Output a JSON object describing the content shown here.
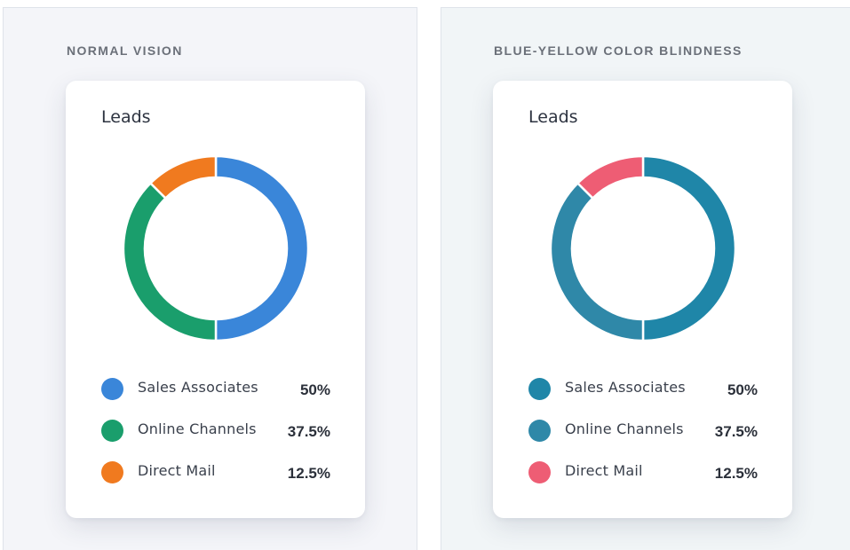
{
  "chart_data": [
    {
      "type": "pie",
      "panel_title": "NORMAL VISION",
      "title": "Leads",
      "categories": [
        "Sales Associates",
        "Online Channels",
        "Direct Mail"
      ],
      "values": [
        50,
        37.5,
        12.5
      ],
      "value_labels": [
        "50%",
        "37.5%",
        "12.5%"
      ],
      "colors": [
        "#3a86d9",
        "#1a9e6c",
        "#f07a1f"
      ],
      "donut": true,
      "legend_placement": "bottom"
    },
    {
      "type": "pie",
      "panel_title": "BLUE-YELLOW COLOR BLINDNESS",
      "title": "Leads",
      "categories": [
        "Sales Associates",
        "Online Channels",
        "Direct Mail"
      ],
      "values": [
        50,
        37.5,
        12.5
      ],
      "value_labels": [
        "50%",
        "37.5%",
        "12.5%"
      ],
      "colors": [
        "#1f86a8",
        "#2f88a8",
        "#ee5d74"
      ],
      "donut": true,
      "legend_placement": "bottom"
    }
  ]
}
